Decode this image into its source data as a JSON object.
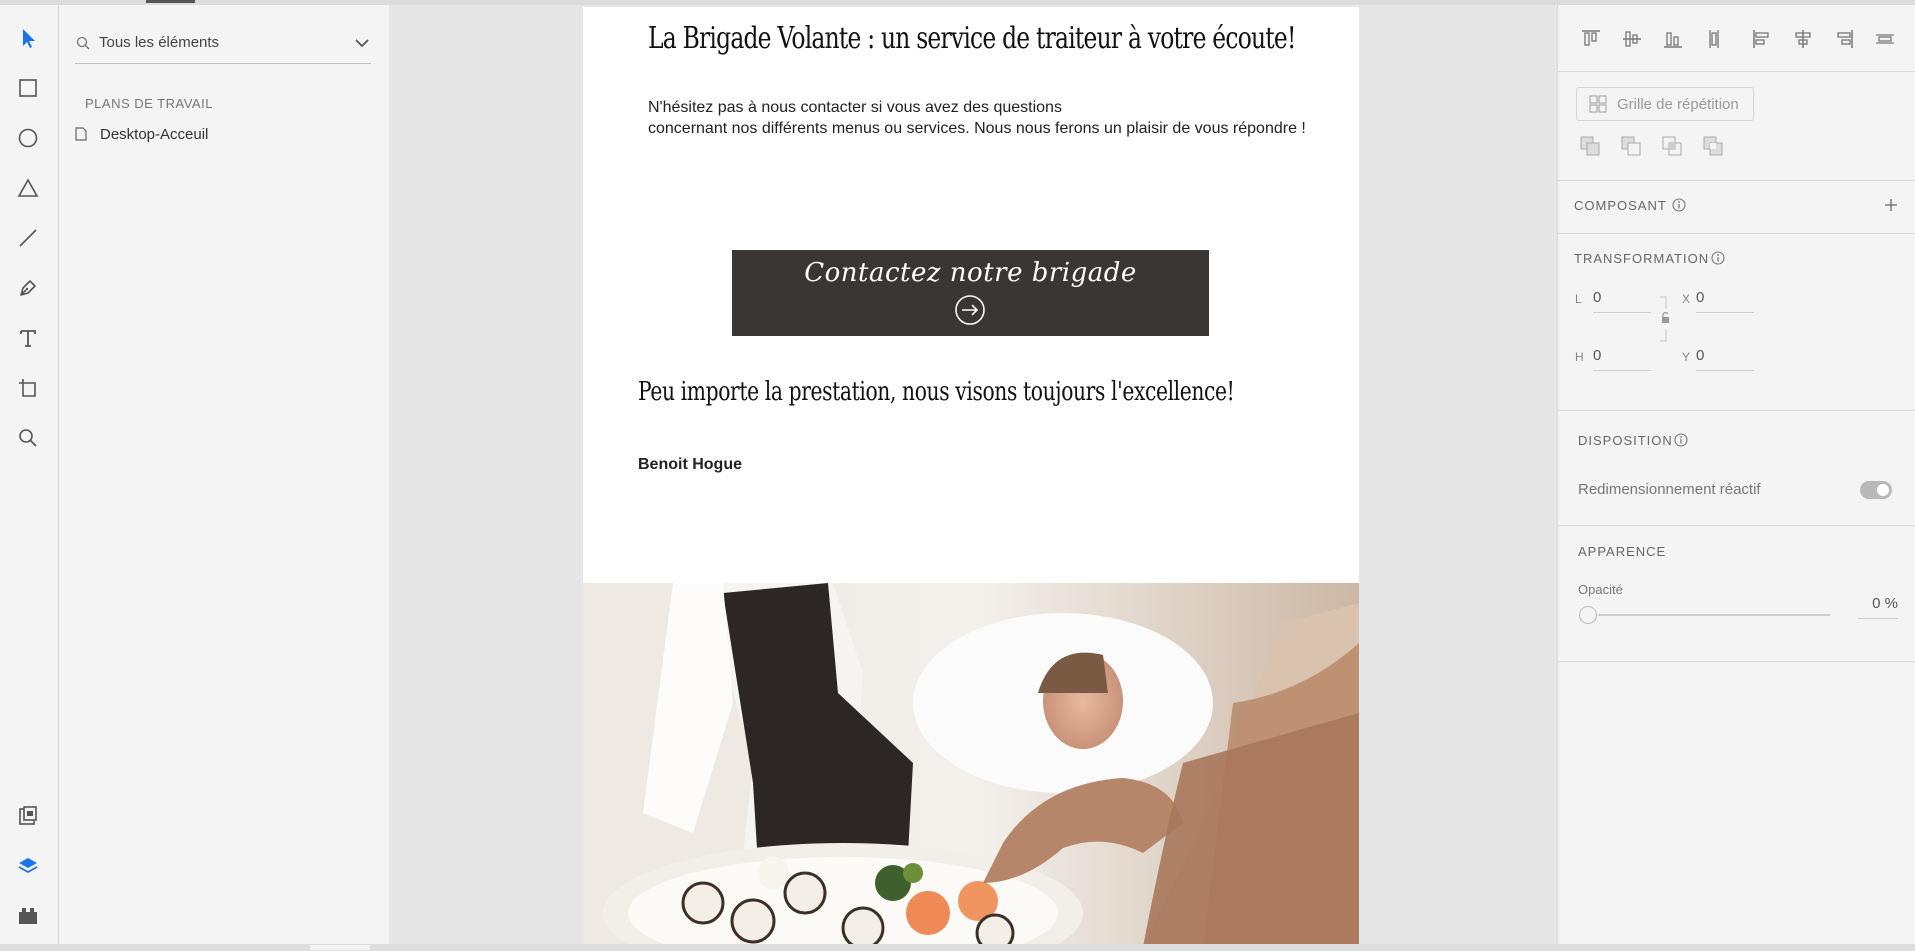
{
  "colors": {
    "accent": "#1a73e8",
    "cta_background": "#3a3634",
    "canvas": "#e6e6e6",
    "panel": "#f4f4f4"
  },
  "tools": [
    {
      "name": "select-tool",
      "icon": "arrow-pointer-icon",
      "active": true
    },
    {
      "name": "rectangle-tool",
      "icon": "rectangle-icon"
    },
    {
      "name": "ellipse-tool",
      "icon": "ellipse-icon"
    },
    {
      "name": "polygon-tool",
      "icon": "triangle-icon"
    },
    {
      "name": "line-tool",
      "icon": "line-icon"
    },
    {
      "name": "pen-tool",
      "icon": "pen-icon"
    },
    {
      "name": "text-tool",
      "icon": "text-icon"
    },
    {
      "name": "artboard-tool",
      "icon": "artboard-icon"
    },
    {
      "name": "zoom-tool",
      "icon": "magnifier-icon"
    }
  ],
  "layers": {
    "search_label": "Tous les éléments",
    "section_title": "PLANS DE TRAVAIL",
    "items": [
      {
        "label": "Desktop-Acceuil"
      }
    ]
  },
  "artboard": {
    "heading": "La Brigade Volante : un service de traiteur à votre écoute!",
    "paragraph_line1": "N'hésitez pas à nous contacter si vous avez des questions",
    "paragraph_line2": "concernant nos différents menus ou services. Nous nous ferons un plaisir de vous répondre !",
    "cta_label": "Contactez notre brigade",
    "subheading": "Peu importe la prestation, nous visons toujours l'excellence!",
    "author": "Benoit Hogue"
  },
  "properties": {
    "repeat_grid_label": "Grille de répétition",
    "component_label": "COMPOSANT",
    "transform_label": "TRANSFORMATION",
    "fields": {
      "l_letter": "L",
      "l_value": "0",
      "x_letter": "X",
      "x_value": "0",
      "h_letter": "H",
      "h_value": "0",
      "y_letter": "Y",
      "y_value": "0"
    },
    "layout_label": "DISPOSITION",
    "responsive_label": "Redimensionnement réactif",
    "appearance_label": "APPARENCE",
    "opacity_label": "Opacité",
    "opacity_value": "0 %"
  }
}
